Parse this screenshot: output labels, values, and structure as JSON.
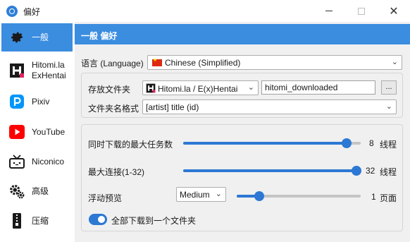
{
  "window": {
    "title": "偏好"
  },
  "sidebar": {
    "items": [
      {
        "label": "一般"
      },
      {
        "label": "Hitomi.la\nExHentai"
      },
      {
        "label": "Pixiv"
      },
      {
        "label": "YouTube"
      },
      {
        "label": "Niconico"
      },
      {
        "label": "高级"
      },
      {
        "label": "压缩"
      }
    ]
  },
  "main": {
    "header": "一般 偏好",
    "language": {
      "label": "语言 (Language)",
      "value": "Chinese (Simplified)"
    },
    "storage": {
      "folder_label": "存放文件夹",
      "site_value": "Hitomi.la / E(x)Hentai",
      "folder_value": "hitomi_downloaded",
      "browse_label": "...",
      "format_label": "文件夹名格式",
      "format_value": "[artist] title (id)"
    },
    "tasks": {
      "max_tasks_label": "同时下载的最大任务数",
      "max_tasks_value": "8",
      "max_tasks_unit": "线程",
      "max_tasks_level": 0.92,
      "max_conn_label": "最大连接(1-32)",
      "max_conn_value": "32",
      "max_conn_unit": "线程",
      "max_conn_level": 1.0,
      "preview_label": "浮动预览",
      "preview_size": "Medium",
      "preview_value": "1",
      "preview_unit": "页面",
      "preview_level": 0.18,
      "single_folder_label": "全部下载到一个文件夹",
      "single_folder_on": true
    }
  },
  "colors": {
    "accent": "#3b8de0",
    "slider": "#2c78d4"
  },
  "icons": [
    "gear-icon",
    "hitomi-icon",
    "pixiv-icon",
    "youtube-icon",
    "niconico-icon",
    "gears-icon",
    "zip-icon",
    "flag-cn-icon"
  ]
}
